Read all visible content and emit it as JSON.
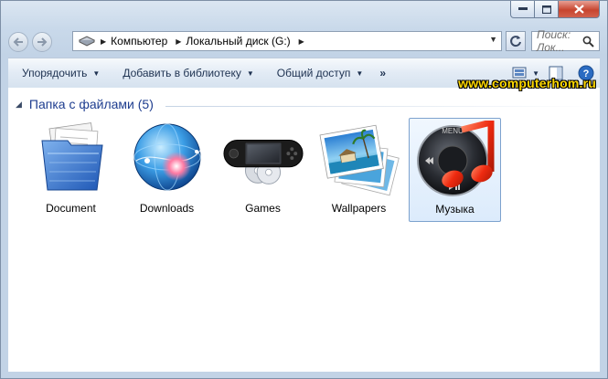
{
  "address": {
    "crumbs": [
      "Компьютер",
      "Локальный диск (G:)"
    ]
  },
  "search": {
    "placeholder": "Поиск: Лок..."
  },
  "toolbar": {
    "organize": "Упорядочить",
    "add_to_library": "Добавить в библиотеку",
    "share": "Общий доступ",
    "more": "»"
  },
  "watermark": "www.computerhom.ru",
  "group": {
    "title": "Папка с файлами (5)"
  },
  "items": [
    {
      "label": "Document",
      "icon": "document-folder-icon"
    },
    {
      "label": "Downloads",
      "icon": "globe-icon"
    },
    {
      "label": "Games",
      "icon": "game-console-icon"
    },
    {
      "label": "Wallpapers",
      "icon": "photos-icon"
    },
    {
      "label": "Музыка",
      "icon": "music-player-icon",
      "selected": true
    }
  ],
  "colors": {
    "accent": "#1e3d8f",
    "selection": "#dcebfc",
    "watermark": "#ffd800"
  }
}
